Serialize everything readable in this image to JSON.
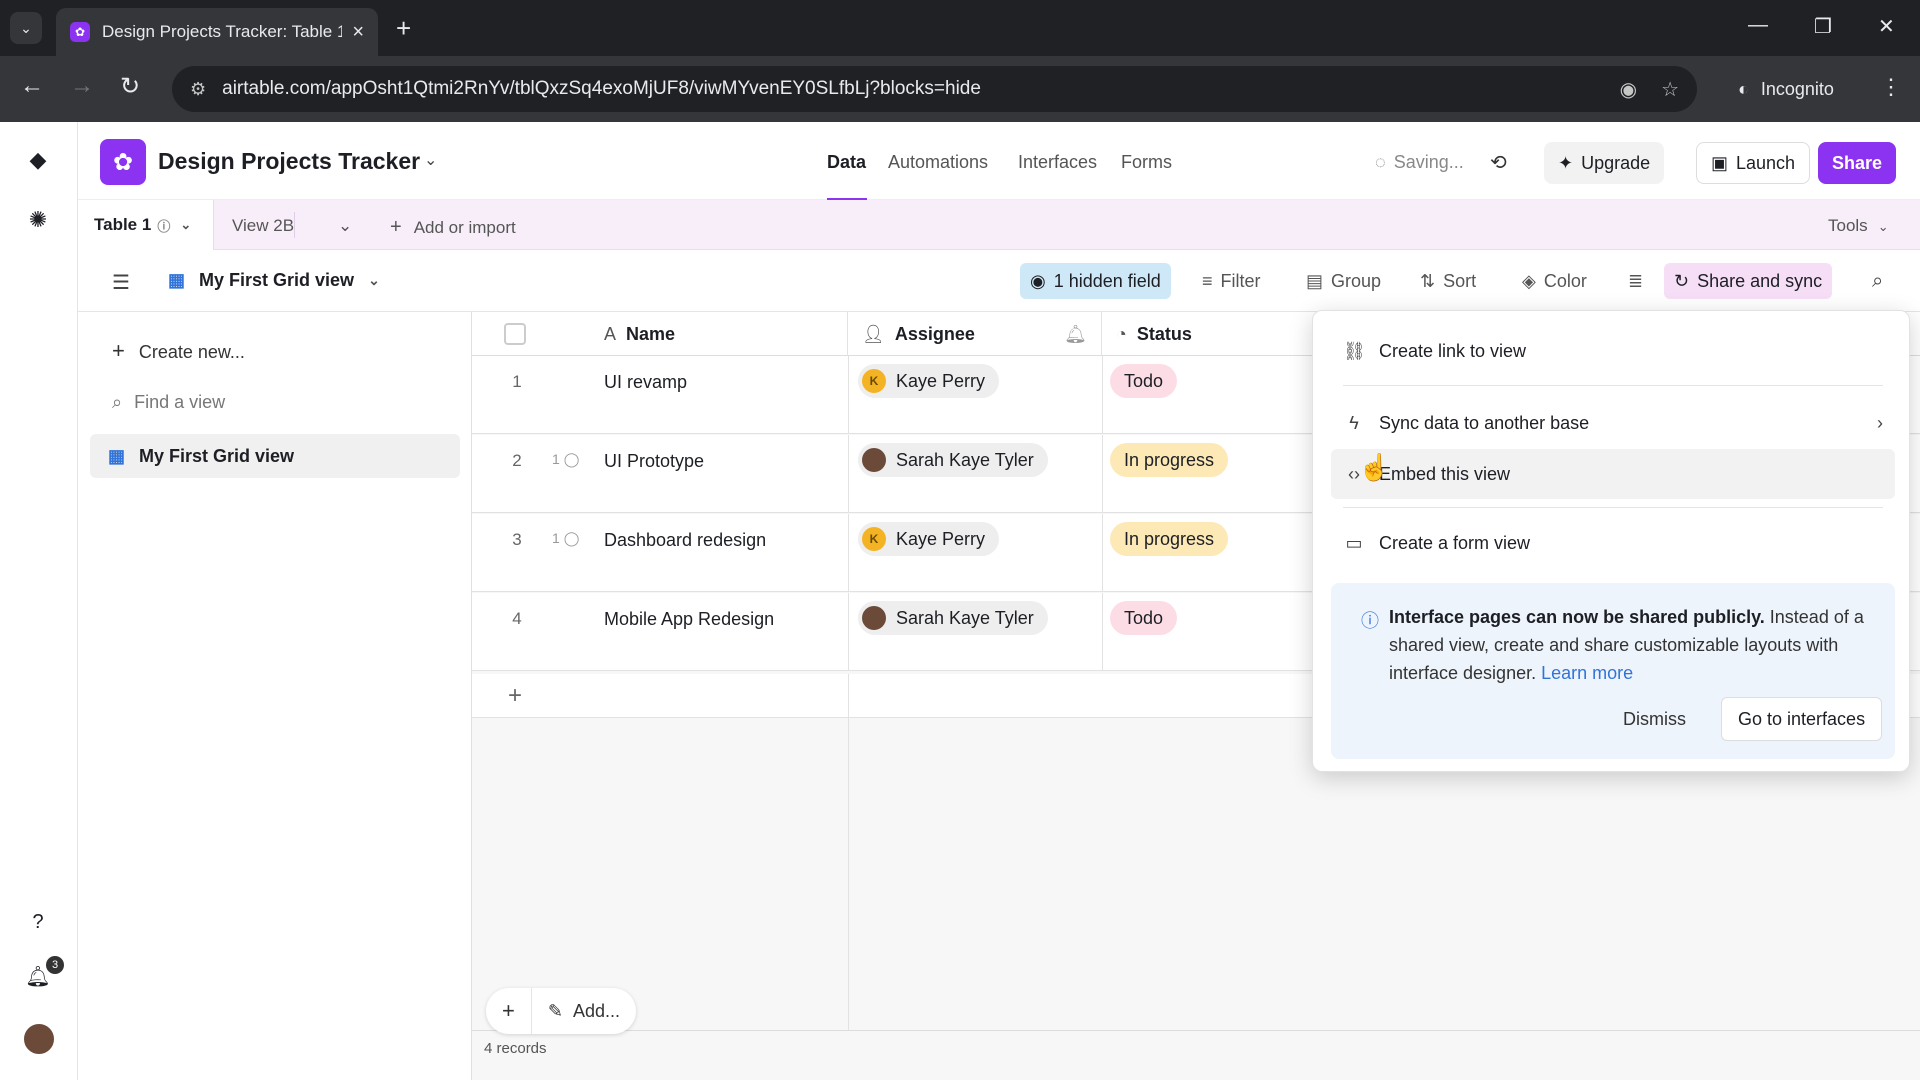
{
  "browser": {
    "tab_title": "Design Projects Tracker: Table 1",
    "url": "airtable.com/appOsht1Qtmi2RnYv/tblQxzSq4exoMjUF8/viwMYvenEY0SLfbLj?blocks=hide",
    "incognito_label": "Incognito"
  },
  "header": {
    "base_name": "Design Projects Tracker",
    "nav": [
      "Data",
      "Automations",
      "Interfaces",
      "Forms"
    ],
    "active_nav": "Data",
    "saving_label": "Saving...",
    "upgrade_label": "Upgrade",
    "launch_label": "Launch",
    "share_label": "Share",
    "accent_color": "#8b33f0"
  },
  "tables_bar": {
    "table_tab": "Table 1",
    "view_tab": "View 2B",
    "add_import": "Add or import",
    "tools": "Tools"
  },
  "view_bar": {
    "view_name": "My First Grid view",
    "hidden_fields": "1 hidden field",
    "filter": "Filter",
    "group": "Group",
    "sort": "Sort",
    "color": "Color",
    "share_sync": "Share and sync"
  },
  "sidebar": {
    "create_new": "Create new...",
    "find_placeholder": "Find a view",
    "active_view": "My First Grid view"
  },
  "grid": {
    "columns": [
      "Name",
      "Assignee",
      "Status"
    ],
    "rows": [
      {
        "num": "1",
        "comments": "",
        "name": "UI revamp",
        "assignee": "Kaye Perry",
        "avatar": "K",
        "status": "Todo"
      },
      {
        "num": "2",
        "comments": "1",
        "name": "UI Prototype",
        "assignee": "Sarah Kaye Tyler",
        "avatar": "",
        "status": "In progress"
      },
      {
        "num": "3",
        "comments": "1",
        "name": "Dashboard redesign",
        "assignee": "Kaye Perry",
        "avatar": "K",
        "status": "In progress"
      },
      {
        "num": "4",
        "comments": "",
        "name": "Mobile App Redesign",
        "assignee": "Sarah Kaye Tyler",
        "avatar": "",
        "status": "Todo"
      }
    ],
    "add_label": "Add...",
    "records": "4 records"
  },
  "popover": {
    "create_link": "Create link to view",
    "sync_data": "Sync data to another base",
    "embed": "Embed this view",
    "create_form": "Create a form view",
    "notice_bold": "Interface pages can now be shared publicly.",
    "notice_text": " Instead of a shared view, create and share customizable layouts with interface designer. ",
    "notice_link": "Learn more",
    "dismiss": "Dismiss",
    "go_interfaces": "Go to interfaces"
  },
  "rail": {
    "notification_count": "3"
  }
}
